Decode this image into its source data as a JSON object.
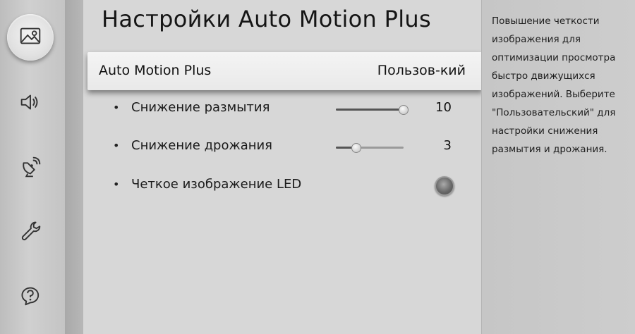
{
  "sidebar": {
    "items": [
      {
        "icon": "picture-icon",
        "active": true
      },
      {
        "icon": "sound-icon",
        "active": false
      },
      {
        "icon": "broadcast-icon",
        "active": false
      },
      {
        "icon": "wrench-icon",
        "active": false
      },
      {
        "icon": "support-icon",
        "active": false
      }
    ]
  },
  "main": {
    "title": "Настройки Auto Motion Plus",
    "focused_item": {
      "label": "Auto Motion Plus",
      "value": "Пользов-кий"
    },
    "sub_items": [
      {
        "label": "Снижение размытия",
        "type": "slider",
        "value": "10",
        "level": 1.0
      },
      {
        "label": "Снижение дрожания",
        "type": "slider",
        "value": "3",
        "level": 0.3
      },
      {
        "label": "Четкое изображение LED",
        "type": "toggle",
        "state": "off"
      }
    ]
  },
  "description": {
    "lines": [
      "Повышение четкости",
      "изображения для",
      "оптимизации просмотра",
      "быстро движущихся",
      "изображений. Выберите",
      "\"Пользовательский\" для",
      "настройки снижения",
      "размытия и дрожания."
    ]
  }
}
